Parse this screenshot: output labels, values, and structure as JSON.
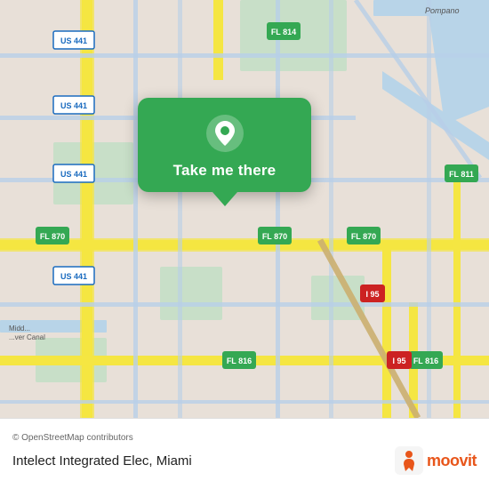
{
  "map": {
    "attribution": "© OpenStreetMap contributors",
    "background_color": "#e8e0d8"
  },
  "popup": {
    "label": "Take me there",
    "pin_color": "#ffffff",
    "background_color": "#34a853"
  },
  "footer": {
    "place_name": "Intelect Integrated Elec, Miami",
    "attribution": "© OpenStreetMap contributors",
    "moovit_text": "moovit"
  }
}
